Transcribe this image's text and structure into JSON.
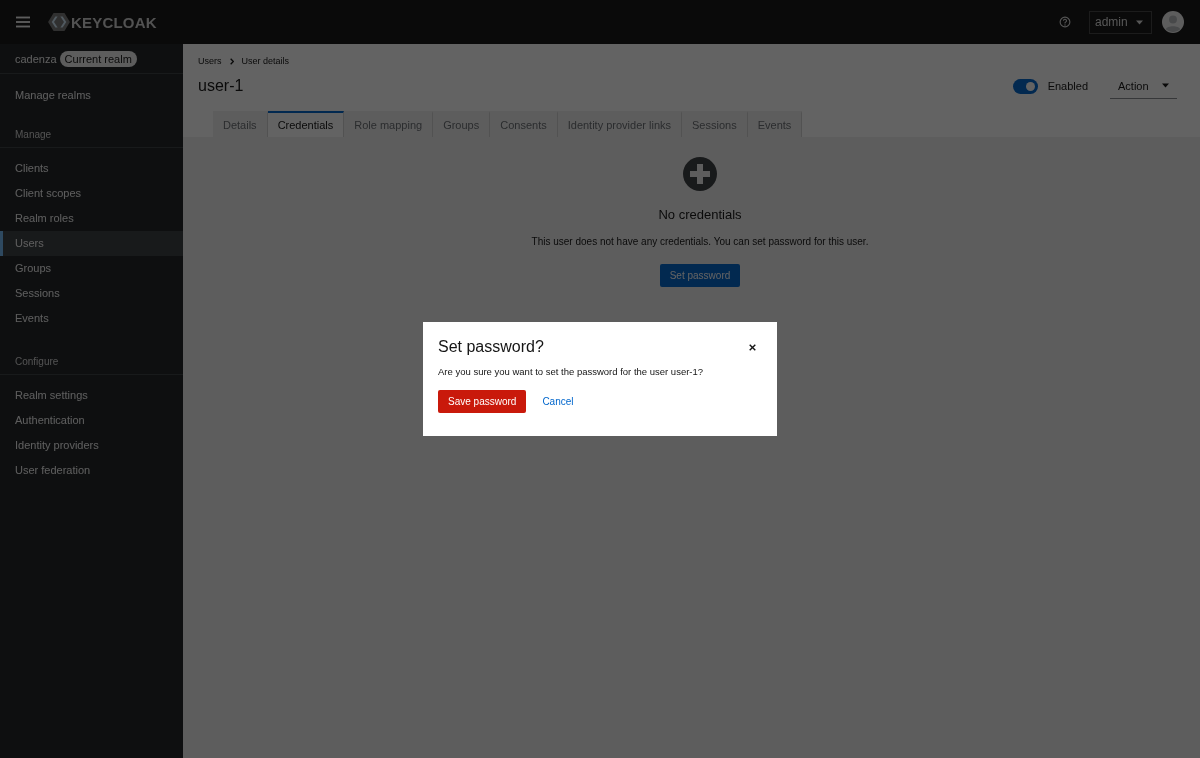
{
  "masthead": {
    "logo": "KEYCLOAK",
    "user_menu": "admin"
  },
  "sidebar": {
    "realm": "cadenza",
    "realm_badge": "Current realm",
    "manage_realms": "Manage realms",
    "sections": [
      {
        "title": "Manage",
        "items": [
          {
            "label": "Clients",
            "selected": false
          },
          {
            "label": "Client scopes",
            "selected": false
          },
          {
            "label": "Realm roles",
            "selected": false
          },
          {
            "label": "Users",
            "selected": true
          },
          {
            "label": "Groups",
            "selected": false
          },
          {
            "label": "Sessions",
            "selected": false
          },
          {
            "label": "Events",
            "selected": false
          }
        ]
      },
      {
        "title": "Configure",
        "items": [
          {
            "label": "Realm settings",
            "selected": false
          },
          {
            "label": "Authentication",
            "selected": false
          },
          {
            "label": "Identity providers",
            "selected": false
          },
          {
            "label": "User federation",
            "selected": false
          }
        ]
      }
    ]
  },
  "breadcrumb": [
    "Users",
    "User details"
  ],
  "page": {
    "title": "user-1",
    "enabled_toggle": {
      "label": "Enabled",
      "on": true
    },
    "action_menu": "Action"
  },
  "tabs": [
    {
      "label": "Details",
      "selected": false
    },
    {
      "label": "Credentials",
      "selected": true
    },
    {
      "label": "Role mapping",
      "selected": false
    },
    {
      "label": "Groups",
      "selected": false
    },
    {
      "label": "Consents",
      "selected": false
    },
    {
      "label": "Identity provider links",
      "selected": false
    },
    {
      "label": "Sessions",
      "selected": false
    },
    {
      "label": "Events",
      "selected": false
    }
  ],
  "empty_state": {
    "title": "No credentials",
    "body": "This user does not have any credentials. You can set password for this user.",
    "button": "Set password"
  },
  "modal": {
    "title": "Set password?",
    "body": "Are you sure you want to set the password for the user user-1?",
    "buttons": [
      {
        "label": "Save password",
        "kind": "primary"
      },
      {
        "label": "Cancel",
        "kind": "link"
      }
    ]
  }
}
